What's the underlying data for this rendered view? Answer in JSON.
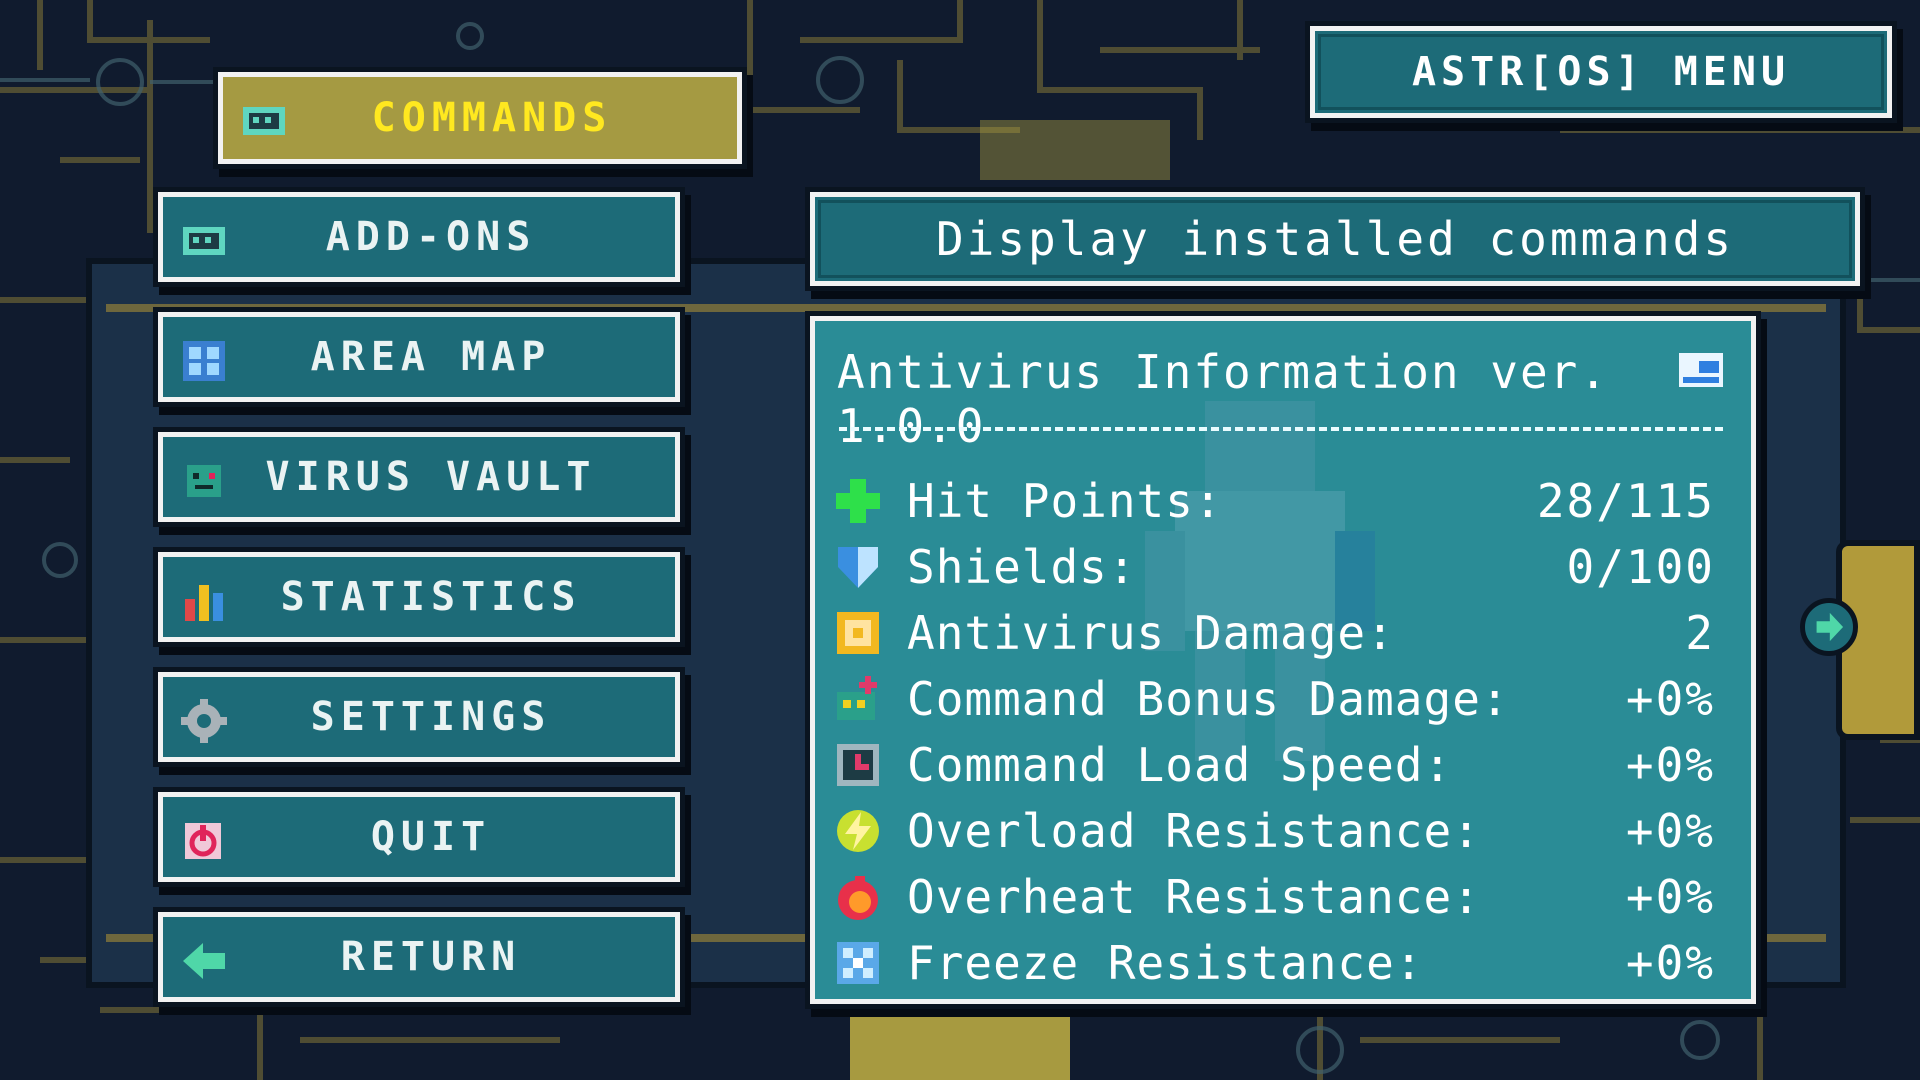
{
  "header": {
    "title": "ASTR[OS] MENU"
  },
  "menu": {
    "items": [
      {
        "key": "commands",
        "label": "COMMANDS",
        "icon": "chip-icon",
        "selected": true
      },
      {
        "key": "addons",
        "label": "ADD-ONS",
        "icon": "chip-icon"
      },
      {
        "key": "areamap",
        "label": "AREA MAP",
        "icon": "map-icon"
      },
      {
        "key": "virusvault",
        "label": "VIRUS VAULT",
        "icon": "virus-icon"
      },
      {
        "key": "statistics",
        "label": "STATISTICS",
        "icon": "bar-chart-icon"
      },
      {
        "key": "settings",
        "label": "SETTINGS",
        "icon": "gear-icon"
      },
      {
        "key": "quit",
        "label": "QUIT",
        "icon": "power-icon"
      },
      {
        "key": "return",
        "label": "RETURN",
        "icon": "back-arrow-icon"
      }
    ]
  },
  "description": "Display installed commands",
  "info": {
    "title": "Antivirus Information ver. 1.0.0",
    "divider": "----------------------------------------",
    "stats": [
      {
        "label": "Hit Points:",
        "value": "28/115",
        "icon": "health-cross-icon"
      },
      {
        "label": "Shields:",
        "value": "0/100",
        "icon": "shield-icon"
      },
      {
        "label": "Antivirus Damage:",
        "value": "2",
        "icon": "target-icon"
      },
      {
        "label": "Command Bonus Damage:",
        "value": "+0%",
        "icon": "bonus-damage-icon"
      },
      {
        "label": "Command Load Speed:",
        "value": "+0%",
        "icon": "load-speed-icon"
      },
      {
        "label": "Overload Resistance:",
        "value": "+0%",
        "icon": "lightning-icon"
      },
      {
        "label": "Overheat Resistance:",
        "value": "+0%",
        "icon": "fire-icon"
      },
      {
        "label": "Freeze Resistance:",
        "value": "+0%",
        "icon": "snowflake-icon"
      }
    ]
  },
  "colors": {
    "panel": "#1d6b78",
    "panel_border": "#f2f2f2",
    "selected_bg": "#a59a42",
    "selected_text": "#ffe820",
    "background": "#0f1a2c",
    "circuit_lines": "#8a7a3a"
  }
}
